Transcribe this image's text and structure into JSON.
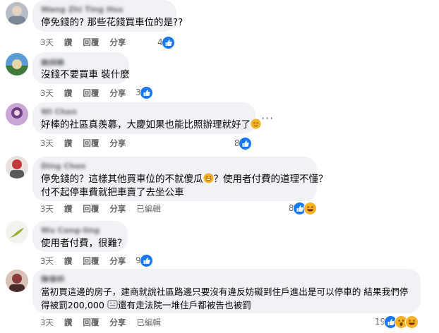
{
  "comments": [
    {
      "name": "Wang Zhi Ting Hsu",
      "lines": [
        "停免錢的? 那些花錢買車位的是??"
      ],
      "time": "3天",
      "like": "讚",
      "reply": "回覆",
      "share": "分享",
      "edited": "",
      "react_count": "4",
      "reactions": [
        "like-icon"
      ],
      "avatar_color": "#9aa5b8"
    },
    {
      "name": "賴翊勝",
      "lines": [
        "沒錢不要買車 裝什麼"
      ],
      "time": "3天",
      "like": "讚",
      "reply": "回覆",
      "share": "分享",
      "edited": "",
      "react_count": "3",
      "reactions": [
        "like-icon"
      ],
      "avatar_color": "#4f8fd0"
    },
    {
      "name": "Wi Chen",
      "lines": [
        "好棒的社區真羨慕，大慶如果也能比照辦理就好了"
      ],
      "time": "3天",
      "like": "讚",
      "reply": "回覆",
      "share": "分享",
      "edited": "",
      "react_count": "8",
      "reactions": [
        "like-icon"
      ],
      "avatar_color": "#8a5aa8"
    },
    {
      "name": "Ding Chen",
      "lines": [
        "停免錢的？這樣其他買車位的不就傻瓜",
        "？使用者付費的道理不懂？",
        "付不起停車費就把車賣了去坐公車"
      ],
      "time": "3天",
      "like": "讚",
      "reply": "回覆",
      "share": "分享",
      "edited": "已編輯",
      "react_count": "8",
      "reactions": [
        "like-icon",
        "haha-icon"
      ],
      "avatar_color": "#c04848"
    },
    {
      "name": "Wu Cong-ling",
      "lines": [
        "使用者付費，很難？"
      ],
      "time": "3天",
      "like": "讚",
      "reply": "回覆",
      "share": "分享",
      "edited": "",
      "react_count": "9",
      "reactions": [
        "like-icon"
      ],
      "avatar_color": "#d8dccf"
    },
    {
      "name": "陳偉明",
      "lines": [
        "當初買這邊的房子，建商就說社區路邊只要沒有違反妨礙到住戶進出是可以停車的 結果我們停",
        "得被罰200,000 ",
        "還有走法院一堆住戶都被告也被罰"
      ],
      "time": "3天",
      "like": "讚",
      "reply": "回覆",
      "share": "分享",
      "edited": "已編輯",
      "react_count": "19",
      "reactions": [
        "like-icon",
        "wow-icon",
        "haha-icon"
      ],
      "avatar_color": "#a55a5a"
    }
  ],
  "more_icon": "more-dots-icon",
  "colors": {
    "bubble": "#f0f2f5",
    "meta_text": "#65676b",
    "like_blue": "#1877f2",
    "haha_yellow": "#f7b125"
  }
}
